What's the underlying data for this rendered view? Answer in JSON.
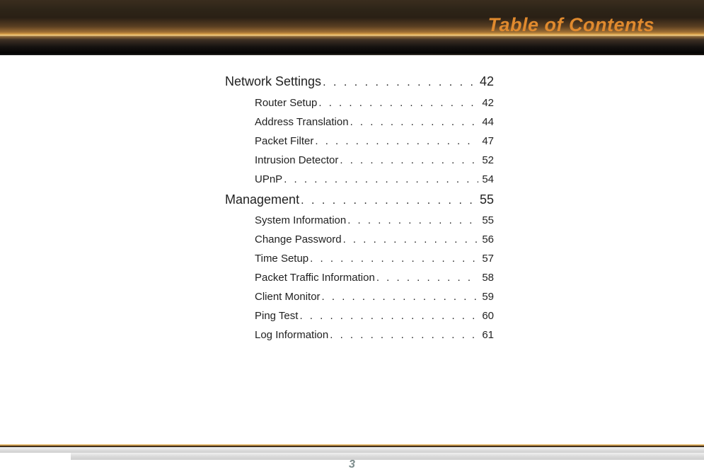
{
  "header": {
    "title": "Table of Contents"
  },
  "toc": {
    "sections": [
      {
        "title": "Network Settings",
        "page": "42",
        "items": [
          {
            "title": "Router Setup",
            "page": "42"
          },
          {
            "title": "Address Translation",
            "page": "44"
          },
          {
            "title": "Packet Filter",
            "page": "47"
          },
          {
            "title": "Intrusion Detector",
            "page": "52"
          },
          {
            "title": "UPnP",
            "page": "54"
          }
        ]
      },
      {
        "title": "Management",
        "page": "55",
        "items": [
          {
            "title": "System Information",
            "page": "55"
          },
          {
            "title": "Change Password",
            "page": "56"
          },
          {
            "title": "Time Setup",
            "page": "57"
          },
          {
            "title": "Packet Traffic Information",
            "page": "58"
          },
          {
            "title": "Client Monitor",
            "page": "59"
          },
          {
            "title": "Ping Test",
            "page": "60"
          },
          {
            "title": "Log Information",
            "page": "61"
          }
        ]
      }
    ]
  },
  "footer": {
    "page_number": "3"
  },
  "leader_dots": ". . . . . . . . . . . . . . . . . . . . . . . . . . . . . . . . . . . . . . . . . . . ."
}
